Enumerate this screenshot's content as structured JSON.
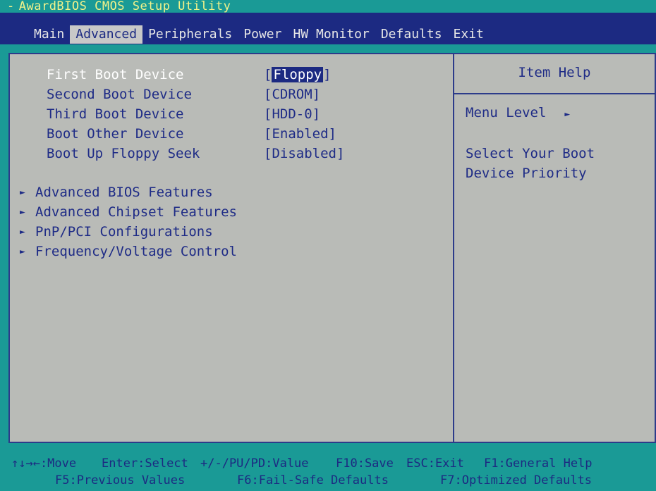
{
  "app": {
    "title": "AwardBIOS CMOS Setup Utility"
  },
  "menu": {
    "items": [
      "Main",
      "Advanced",
      "Peripherals",
      "Power",
      "HW Monitor",
      "Defaults",
      "Exit"
    ],
    "active": "Advanced"
  },
  "settings": [
    {
      "label": "First Boot Device",
      "value": "Floppy",
      "selected": true
    },
    {
      "label": "Second Boot Device",
      "value": "[CDROM]"
    },
    {
      "label": "Third Boot Device",
      "value": "[HDD-0]"
    },
    {
      "label": "Boot Other Device",
      "value": "[Enabled]"
    },
    {
      "label": "Boot Up Floppy Seek",
      "value": "[Disabled]"
    }
  ],
  "submenus": [
    "Advanced BIOS Features",
    "Advanced Chipset Features",
    "PnP/PCI Configurations",
    "Frequency/Voltage Control"
  ],
  "help": {
    "title": "Item Help",
    "menu_level": "Menu Level",
    "description": "Select Your Boot Device Priority"
  },
  "footer": {
    "line1": [
      "↑↓→←:Move",
      "Enter:Select",
      "+/-/PU/PD:Value",
      "F10:Save",
      "ESC:Exit",
      "F1:General Help"
    ],
    "line2": [
      "F5:Previous Values",
      "F6:Fail-Safe Defaults",
      "F7:Optimized Defaults"
    ]
  },
  "colors": {
    "background": "#1a9a96",
    "menu_bar": "#1c2a82",
    "panel": "#b9bbb7",
    "text": "#1e2b86",
    "highlight": "#1c2a82",
    "title_text": "#f2f28a"
  }
}
